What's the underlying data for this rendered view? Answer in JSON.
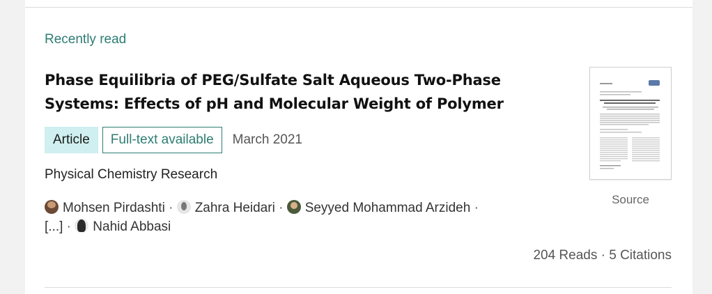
{
  "section": {
    "label": "Recently read"
  },
  "publication": {
    "title": "Phase Equilibria of PEG/Sulfate Salt Aqueous Two-Phase Systems: Effects of pH and Molecular Weight of Polymer",
    "type_badge": "Article",
    "availability_badge": "Full-text available",
    "date": "March 2021",
    "journal": "Physical Chemistry Research",
    "authors": [
      {
        "name": "Mohsen Pirdashti",
        "avatar": "person-avatar"
      },
      {
        "name": "Zahra Heidari",
        "avatar": "person-avatar"
      },
      {
        "name": "Seyyed Mohammad Arzideh",
        "avatar": "person-avatar"
      },
      {
        "name": "Nahid Abbasi",
        "avatar": "person-avatar"
      }
    ],
    "authors_ellipsis": "[...]",
    "separator": " · ",
    "stats": "204 Reads · 5 Citations",
    "source_label": "Source"
  },
  "colors": {
    "accent": "#2d7d73",
    "badge_bg": "#cfeff0"
  }
}
